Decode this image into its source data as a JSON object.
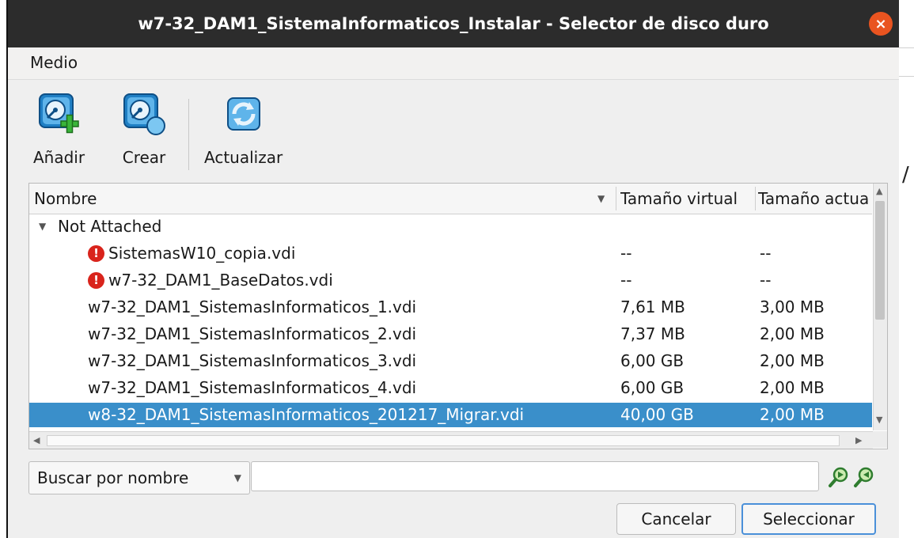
{
  "window": {
    "title": "w7-32_DAM1_SistemaInformaticos_Instalar - Selector de disco duro",
    "close_label": "×"
  },
  "menu": {
    "items": [
      {
        "label": "Medio"
      }
    ]
  },
  "toolbar": {
    "add_label": "Añadir",
    "create_label": "Crear",
    "refresh_label": "Actualizar"
  },
  "table": {
    "columns": [
      "Nombre",
      "Tamaño virtual",
      "Tamaño actual"
    ],
    "group": {
      "label": "Not Attached"
    },
    "rows": [
      {
        "name": "SistemasW10_copia.vdi",
        "virtual": "--",
        "actual": "--",
        "warning": true,
        "selected": false
      },
      {
        "name": "w7-32_DAM1_BaseDatos.vdi",
        "virtual": "--",
        "actual": "--",
        "warning": true,
        "selected": false
      },
      {
        "name": "w7-32_DAM1_SistemasInformaticos_1.vdi",
        "virtual": "7,61 MB",
        "actual": "3,00 MB",
        "warning": false,
        "selected": false
      },
      {
        "name": "w7-32_DAM1_SistemasInformaticos_2.vdi",
        "virtual": "7,37 MB",
        "actual": "2,00 MB",
        "warning": false,
        "selected": false
      },
      {
        "name": "w7-32_DAM1_SistemasInformaticos_3.vdi",
        "virtual": "6,00 GB",
        "actual": "2,00 MB",
        "warning": false,
        "selected": false
      },
      {
        "name": "w7-32_DAM1_SistemasInformaticos_4.vdi",
        "virtual": "6,00 GB",
        "actual": "2,00 MB",
        "warning": false,
        "selected": false
      },
      {
        "name": "w8-32_DAM1_SistemasInformaticos_201217_Migrar.vdi",
        "virtual": "40,00 GB",
        "actual": "2,00 MB",
        "warning": false,
        "selected": true
      }
    ],
    "warning_glyph": "!"
  },
  "search": {
    "mode_label": "Buscar por nombre",
    "value": "",
    "placeholder": ""
  },
  "buttons": {
    "cancel_label": "Cancelar",
    "select_label": "Seleccionar"
  },
  "colors": {
    "selection": "#3a8fca",
    "close": "#e95420",
    "warning": "#d9241c",
    "titlebar": "#2c2c2c"
  },
  "icons": {
    "add": "hard-disk-add-icon",
    "create": "hard-disk-create-icon",
    "refresh": "refresh-icon",
    "find_next": "find-next-icon",
    "find_prev": "find-previous-icon"
  }
}
